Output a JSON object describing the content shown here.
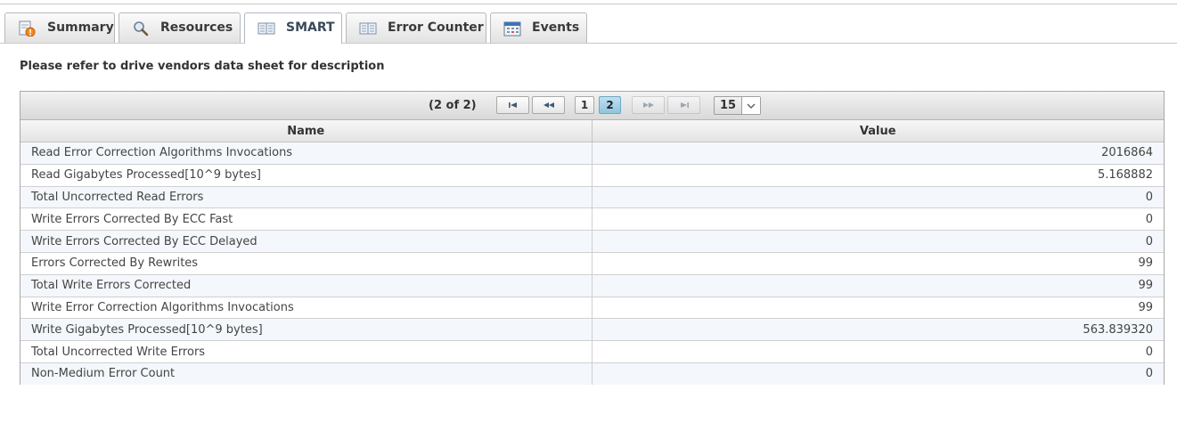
{
  "tabs": [
    {
      "label": "Summary",
      "icon": "info-warning-icon"
    },
    {
      "label": "Resources",
      "icon": "magnifier-icon"
    },
    {
      "label": "SMART",
      "icon": "table-icon",
      "active": true
    },
    {
      "label": "Error Counter",
      "icon": "table-icon"
    },
    {
      "label": "Events",
      "icon": "calendar-icon"
    }
  ],
  "note": "Please refer to drive vendors data sheet for description",
  "paginator": {
    "current": "(2 of 2)",
    "pages": [
      "1",
      "2"
    ],
    "rows_per_page": "15"
  },
  "table": {
    "headers": {
      "name": "Name",
      "value": "Value"
    },
    "rows": [
      {
        "name": "Read Error Correction Algorithms Invocations",
        "value": "2016864"
      },
      {
        "name": "Read Gigabytes Processed[10^9 bytes]",
        "value": "5.168882"
      },
      {
        "name": "Total Uncorrected Read Errors",
        "value": "0"
      },
      {
        "name": "Write Errors Corrected By ECC Fast",
        "value": "0"
      },
      {
        "name": "Write Errors Corrected By ECC Delayed",
        "value": "0"
      },
      {
        "name": "Errors Corrected By Rewrites",
        "value": "99"
      },
      {
        "name": "Total Write Errors Corrected",
        "value": "99"
      },
      {
        "name": "Write Error Correction Algorithms Invocations",
        "value": "99"
      },
      {
        "name": "Write Gigabytes Processed[10^9 bytes]",
        "value": "563.839320"
      },
      {
        "name": "Total Uncorrected Write Errors",
        "value": "0"
      },
      {
        "name": "Non-Medium Error Count",
        "value": "0"
      }
    ]
  },
  "colors": {
    "accent_page": "#8fc5dd",
    "row_alt": "#f4f7fb",
    "header_bg": "#e4e4e4"
  }
}
